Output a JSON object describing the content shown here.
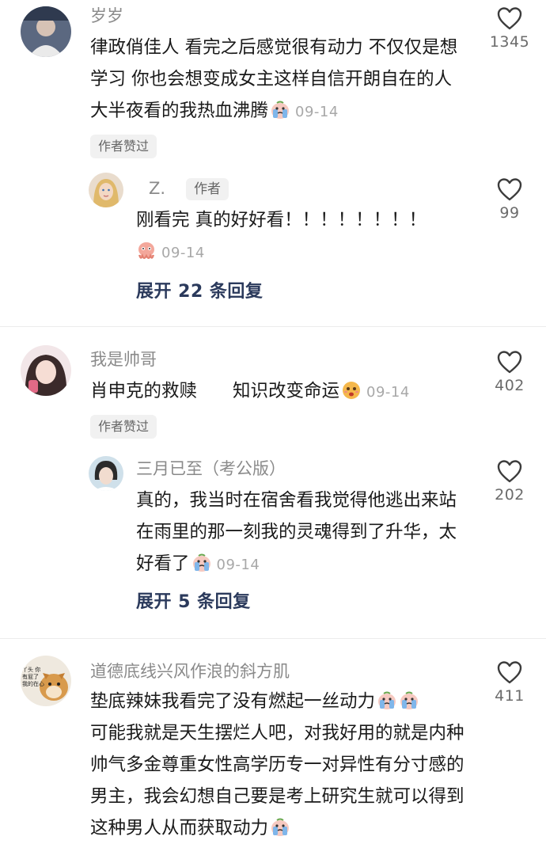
{
  "threads": [
    {
      "user": "岁岁",
      "text": "律政俏佳人 看完之后感觉很有动力 不仅仅是想学习 你也会想变成女主这样自信开朗自在的人 大半夜看的我热血沸腾",
      "date": "09-14",
      "likes": "1345",
      "badge": "作者赞过",
      "reply": {
        "user": "Z.",
        "tag": "作者",
        "text": "刚看完 真的好好看！！！！！！！！",
        "date": "09-14",
        "likes": "99"
      },
      "expand": "展开 22 条回复"
    },
    {
      "user": "我是帅哥",
      "text": "肖申克的救赎　　知识改变命运",
      "date": "09-14",
      "likes": "402",
      "badge": "作者赞过",
      "reply": {
        "user": "三月已至（考公版）",
        "text": "真的，我当时在宿舍看我觉得他逃出来站在雨里的那一刻我的灵魂得到了升华，太好看了",
        "date": "09-14",
        "likes": "202"
      },
      "expand": "展开 5 条回复"
    },
    {
      "user": "道德底线兴风作浪的斜方肌",
      "avatar_text": "丫头 你有屁了 我的在心",
      "text": "垫底辣妹我看完了没有燃起一丝动力",
      "text2": "可能我就是天生摆烂人吧，对我好用的就是内种帅气多金尊重女性高学历专一对异性有分寸感的男主，我会幻想自己要是考上研究生就可以得到这种男人从而获取动力",
      "likes": "411"
    }
  ],
  "colors": {
    "accent": "#2b3a5c",
    "muted": "#8a8a8a",
    "badge_bg": "#f1f1f1"
  },
  "icons": [
    "heart-outline-icon",
    "crying-emoji-icon",
    "face-emoji-icon"
  ]
}
